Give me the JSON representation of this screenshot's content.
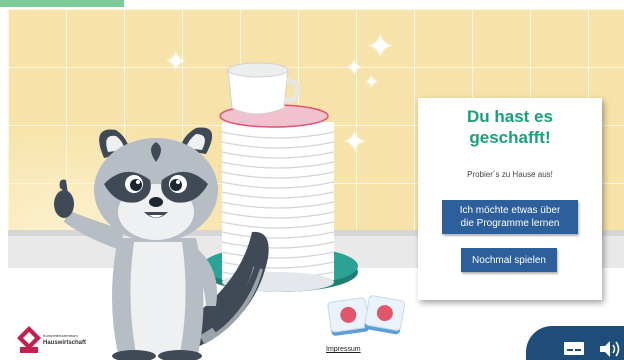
{
  "dialog": {
    "title_line1": "Du hast es",
    "title_line2": "geschafft!",
    "subtitle": "Probier´s zu Hause aus!",
    "learn_button_line1": "Ich möchte etwas über",
    "learn_button_line2": "die Programme lernen",
    "replay_button": "Nochmal spielen"
  },
  "logo": {
    "line1": "Kompetenzzentrum",
    "line2": "Hauswirtschaft"
  },
  "footer": {
    "impressum": "Impressum"
  },
  "nav": {
    "icons": [
      "subtitles-icon",
      "speaker-icon"
    ]
  },
  "colors": {
    "title_green": "#1aa07a",
    "button_blue": "#2c5f9c",
    "nav_blue": "#1d4d78",
    "wall": "#f7e3a9",
    "accent_green": "#7ecb9a"
  }
}
